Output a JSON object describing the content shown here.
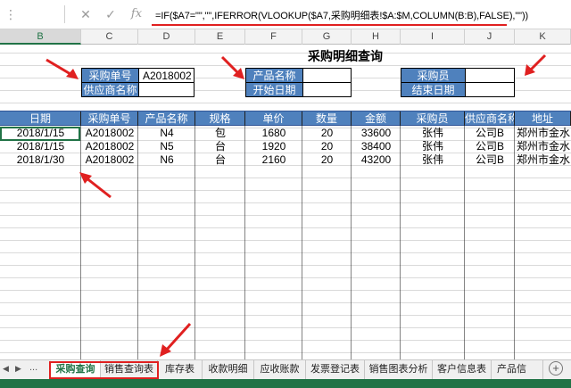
{
  "formula": "=IF($A7=\"\",\"\",IFERROR(VLOOKUP($A7,采购明细表!$A:$M,COLUMN(B:B),FALSE),\"\"))",
  "formula_bar": {
    "cancel_icon": "close-icon",
    "enter_icon": "check-icon",
    "fx_label": "fx"
  },
  "columns": [
    "B",
    "C",
    "D",
    "E",
    "F",
    "G",
    "H",
    "I",
    "J",
    "K"
  ],
  "title": "采购明细查询",
  "criteria": {
    "purchase_no_label": "采购单号",
    "purchase_no_value": "A2018002",
    "supplier_label": "供应商名称",
    "supplier_value": "",
    "product_label": "产品名称",
    "product_value": "",
    "start_date_label": "开始日期",
    "start_date_value": "",
    "buyer_label": "采购员",
    "buyer_value": "",
    "end_date_label": "结束日期",
    "end_date_value": ""
  },
  "table": {
    "headers": [
      "日期",
      "采购单号",
      "产品名称",
      "规格",
      "单价",
      "数量",
      "金额",
      "采购员",
      "供应商名称",
      "地址"
    ],
    "rows": [
      [
        "2018/1/15",
        "A2018002",
        "N4",
        "包",
        "1680",
        "20",
        "33600",
        "张伟",
        "公司B",
        "郑州市金水区"
      ],
      [
        "2018/1/15",
        "A2018002",
        "N5",
        "台",
        "1920",
        "20",
        "38400",
        "张伟",
        "公司B",
        "郑州市金水区"
      ],
      [
        "2018/1/30",
        "A2018002",
        "N6",
        "台",
        "2160",
        "20",
        "43200",
        "张伟",
        "公司B",
        "郑州市金水区"
      ]
    ]
  },
  "sheet_tabs": [
    "采购查询",
    "销售查询表",
    "库存表",
    "收款明细",
    "应收账款",
    "发票登记表",
    "销售图表分析",
    "客户信息表",
    "产品信"
  ],
  "nav": {
    "prev": "◀",
    "next": "▶",
    "more": "...",
    "add": "+"
  },
  "accent_colors": {
    "header_blue": "#4f81bd",
    "excel_green": "#217346",
    "annotation_red": "#e02020"
  }
}
